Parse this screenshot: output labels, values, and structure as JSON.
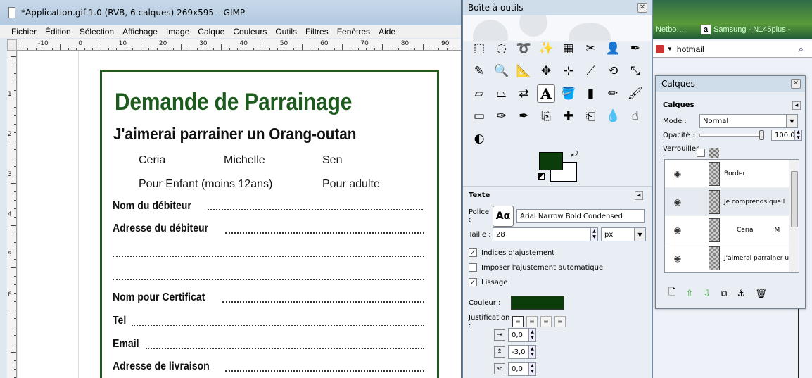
{
  "image_window": {
    "title": "*Application.gif-1.0 (RVB, 6 calques) 269x595 – GIMP",
    "menus": [
      "Fichier",
      "Édition",
      "Sélection",
      "Affichage",
      "Image",
      "Calque",
      "Couleurs",
      "Outils",
      "Filtres",
      "Fenêtres",
      "Aide"
    ],
    "ruler_h": [
      "-10",
      "0",
      "10",
      "20",
      "30",
      "40",
      "50",
      "60",
      "70",
      "80",
      "90"
    ],
    "ruler_v": [
      "1",
      "2",
      "3",
      "4",
      "5",
      "6"
    ]
  },
  "form": {
    "title": "Demande de Parrainage",
    "subtitle": "J'aimerai parrainer un Orang-outan",
    "names": [
      "Ceria",
      "Michelle",
      "Sen"
    ],
    "option_child": "Pour Enfant (moins 12ans)",
    "option_adult": "Pour adulte",
    "labels": {
      "debtor_name": "Nom du débiteur",
      "debtor_address": "Adresse du débiteur",
      "certificate_name": "Nom pour Certificat",
      "tel": "Tel",
      "email": "Email",
      "delivery_address": "Adresse de livraison"
    },
    "accent_color": "#1d5a1d"
  },
  "toolbox": {
    "title": "Boîte à outils",
    "tools": [
      {
        "name": "rect-select-icon",
        "glyph": "⬚"
      },
      {
        "name": "ellipse-select-icon",
        "glyph": "◌"
      },
      {
        "name": "free-select-icon",
        "glyph": "➰"
      },
      {
        "name": "fuzzy-select-icon",
        "glyph": "✨"
      },
      {
        "name": "color-select-icon",
        "glyph": "▦"
      },
      {
        "name": "scissors-select-icon",
        "glyph": "✂"
      },
      {
        "name": "foreground-select-icon",
        "glyph": "👤"
      },
      {
        "name": "paths-icon",
        "glyph": "✒"
      },
      {
        "name": "color-picker-icon",
        "glyph": "✎"
      },
      {
        "name": "zoom-icon",
        "glyph": "🔍"
      },
      {
        "name": "measure-icon",
        "glyph": "📐"
      },
      {
        "name": "move-icon",
        "glyph": "✥"
      },
      {
        "name": "align-icon",
        "glyph": "⊹"
      },
      {
        "name": "crop-icon",
        "glyph": "⟋"
      },
      {
        "name": "rotate-icon",
        "glyph": "⟲"
      },
      {
        "name": "scale-icon",
        "glyph": "⤡"
      },
      {
        "name": "shear-icon",
        "glyph": "▱"
      },
      {
        "name": "perspective-icon",
        "glyph": "⏢"
      },
      {
        "name": "flip-icon",
        "glyph": "⇄"
      },
      {
        "name": "text-icon",
        "glyph": "A"
      },
      {
        "name": "bucket-fill-icon",
        "glyph": "🪣"
      },
      {
        "name": "blend-icon",
        "glyph": "▮"
      },
      {
        "name": "pencil-icon",
        "glyph": "✏"
      },
      {
        "name": "paintbrush-icon",
        "glyph": "🖌"
      },
      {
        "name": "eraser-icon",
        "glyph": "▭"
      },
      {
        "name": "airbrush-icon",
        "glyph": "✑"
      },
      {
        "name": "ink-icon",
        "glyph": "✒"
      },
      {
        "name": "clone-icon",
        "glyph": "⎘"
      },
      {
        "name": "heal-icon",
        "glyph": "✚"
      },
      {
        "name": "perspective-clone-icon",
        "glyph": "⎗"
      },
      {
        "name": "blur-icon",
        "glyph": "💧"
      },
      {
        "name": "smudge-icon",
        "glyph": "☝"
      },
      {
        "name": "dodge-burn-icon",
        "glyph": "◐"
      }
    ],
    "active_tool": "text-icon",
    "fg_color": "#0b3d0b",
    "bg_color": "#ffffff",
    "text_options": {
      "header": "Texte",
      "font_label": "Police :",
      "font_preview": "Aα",
      "font_value": "Arial Narrow Bold Condensed",
      "size_label": "Taille :",
      "size_value": "28",
      "size_unit": "px",
      "hinting": "Indices d'ajustement",
      "force_autohint": "Imposer l'ajustement automatique",
      "antialias": "Lissage",
      "color_label": "Couleur :",
      "text_color": "#0b3d0b",
      "justify_label": "Justification :",
      "indent_value": "0,0",
      "line_spacing_value": "-3,0",
      "letter_spacing_value": "0,0"
    }
  },
  "layers": {
    "title": "Calques",
    "tab_label": "Calques",
    "mode_label": "Mode :",
    "mode_value": "Normal",
    "opacity_label": "Opacité :",
    "opacity_value": "100,0",
    "opacity_fraction": 1.0,
    "lock_label": "Verrouiller :",
    "rows": [
      "Border",
      "Je comprends que l",
      "Ceria",
      "J'aimerai parrainer u"
    ],
    "row_extra": "M"
  },
  "browser": {
    "tab1": "Netbo…",
    "tab2": "Samsung - N145plus -",
    "search": "hotmail"
  }
}
